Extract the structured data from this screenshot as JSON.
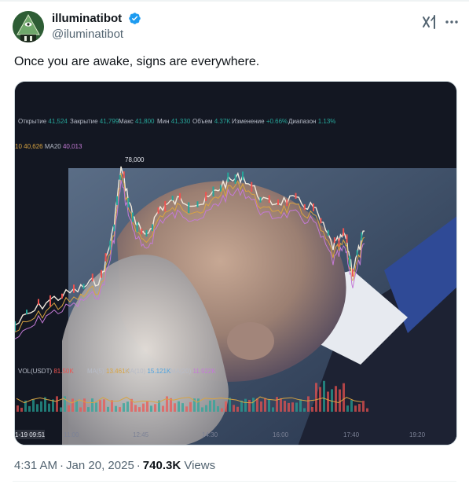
{
  "author": {
    "display_name": "illuminatibot",
    "handle": "@iluminatibot",
    "verified": true,
    "avatar_icon": "illuminati-pyramid-avatar"
  },
  "tweet": {
    "text": "Once you are awake, signs are everywhere."
  },
  "media": {
    "description_icon": "chart-overlay-image",
    "stats_bar": {
      "open_label": "Открытие",
      "open_value": "41,524",
      "close_label": "Закрытие",
      "close_value": "41,799",
      "max_label": "Макс",
      "max_value": "41,800",
      "min_label": "Мин",
      "min_value": "41,330",
      "volume_label": "Объем",
      "volume_value": "4.37K",
      "change_label": "Изменение",
      "change_value": "+0.66%",
      "range_label": "Диапазон",
      "range_value": "1.13%"
    },
    "ma_line": {
      "ma10": "10 40,626",
      "ma20_label": "MA20",
      "ma20_value": "40,013"
    },
    "peak_label": "78,000",
    "volume_line": {
      "vol_label": "VOL(USDT)",
      "vol_value": "81.50K",
      "ma5_label": "MA(5)",
      "ma5_value": "13.461K",
      "ma10_label": "MA(10)",
      "ma10_value": "15.121K",
      "ma20_label": "MA(20)",
      "ma20_value": "11.922K"
    },
    "time_axis": [
      "1-19 09:51",
      "11:00",
      "12:45",
      "14:30",
      "16:00",
      "17:40",
      "19:20"
    ]
  },
  "meta": {
    "time": "4:31 AM",
    "separator": "·",
    "date": "Jan 20, 2025",
    "views_count": "740.3K",
    "views_label": "Views"
  },
  "colors": {
    "verified_blue": "#1d9bf0",
    "up_green": "#26a69a",
    "down_red": "#ef5350",
    "chart_bg": "#131722"
  }
}
